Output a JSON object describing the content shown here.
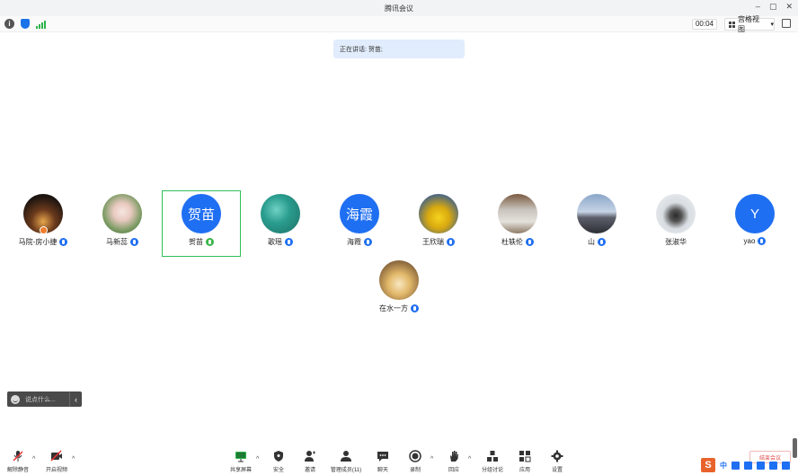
{
  "window": {
    "title": "腾讯会议",
    "controls": [
      "–",
      "▢",
      "✕"
    ]
  },
  "status": {
    "timer": "00:04",
    "view_label": "宫格视图",
    "view_caret": "▾"
  },
  "speaking": {
    "text": "正在讲话: 贺苗;"
  },
  "participants": [
    {
      "name": "马院-房小捷",
      "avatar": "photo",
      "mic": "blue",
      "host": true
    },
    {
      "name": "马新蕊",
      "avatar": "photo",
      "mic": "blue"
    },
    {
      "name": "贺苗",
      "avatar": "text",
      "avatar_text": "贺苗",
      "mic": "green",
      "active": true
    },
    {
      "name": "歌瑶",
      "avatar": "photo",
      "mic": "blue"
    },
    {
      "name": "海霞",
      "avatar": "text",
      "avatar_text": "海霞",
      "mic": "blue"
    },
    {
      "name": "王欣瑞",
      "avatar": "photo",
      "mic": "blue"
    },
    {
      "name": "杜轶伦",
      "avatar": "photo",
      "mic": "blue"
    },
    {
      "name": "山",
      "avatar": "photo",
      "mic": "blue"
    },
    {
      "name": "张淑华",
      "avatar": "photo",
      "mic": "none"
    },
    {
      "name": "yao",
      "avatar": "text",
      "avatar_text": "Y",
      "mic": "blue"
    },
    {
      "name": "在水一方",
      "avatar": "photo",
      "mic": "blue"
    }
  ],
  "chat": {
    "placeholder": "说点什么...",
    "arrow": "‹"
  },
  "toolbar": {
    "unmute": "解除静音",
    "start_video": "开启视频",
    "share_screen": "共享屏幕",
    "security": "安全",
    "invite": "邀请",
    "manage_members": "管理成员(11)",
    "chat": "聊天",
    "record": "录制",
    "reactions": "回应",
    "breakout": "分组讨论",
    "apps": "应用",
    "settings": "设置",
    "caret": "^"
  },
  "end_meeting": "结束会议",
  "ime": {
    "logo": "S",
    "lang": "中"
  },
  "colors": {
    "accent": "#1f6ff2",
    "active_border": "#2fbf5a",
    "mic_green": "#3bb54a"
  }
}
